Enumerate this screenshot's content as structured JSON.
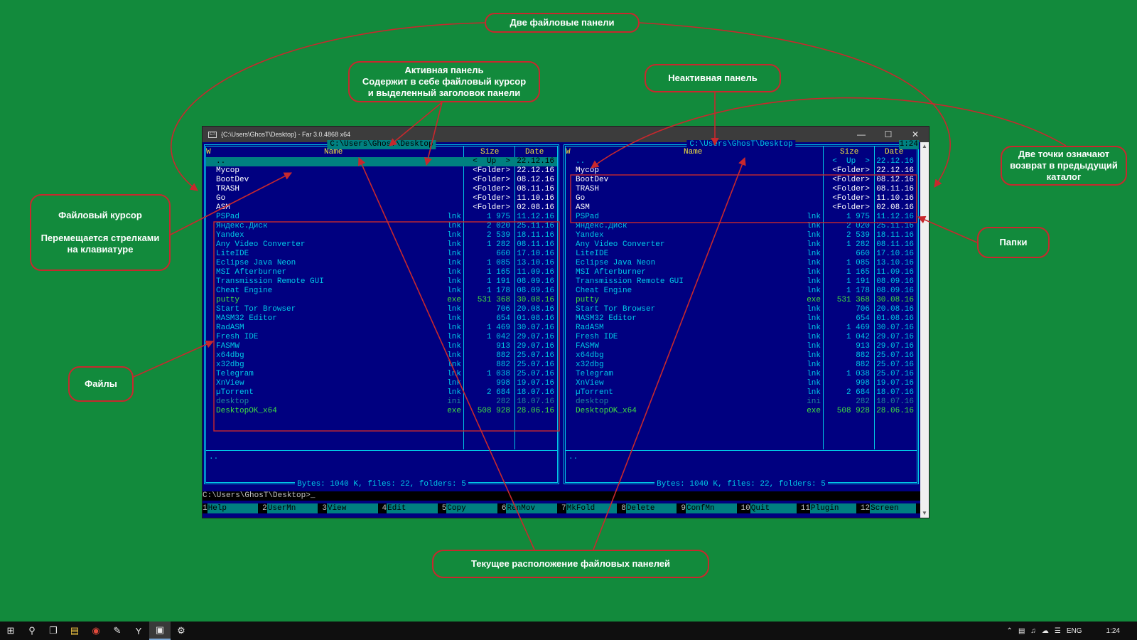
{
  "window": {
    "title": "{C:\\Users\\GhosT\\Desktop} - Far 3.0.4868 x64"
  },
  "left_panel": {
    "path": " C:\\Users\\GhosT\\Desktop ",
    "col_w": "W",
    "col_name": "Name",
    "col_size": "Size",
    "col_date": "Date",
    "info": "..",
    "status": " Bytes: 1040 K, files: 22, folders: 5 "
  },
  "right_panel": {
    "path": " C:\\Users\\GhosT\\Desktop ",
    "col_w": "W",
    "col_name": "Name",
    "col_size": "Size",
    "col_date": "Date",
    "clock": "1:24",
    "info": "..",
    "status": " Bytes: 1040 K, files: 22, folders: 5 "
  },
  "files": [
    {
      "name": "..",
      "ext": "",
      "size": "<  Up  >",
      "date": "22.12.16",
      "type": "up"
    },
    {
      "name": "Мусор",
      "ext": "",
      "size": "<Folder>",
      "date": "22.12.16",
      "type": "folder"
    },
    {
      "name": "BootDev",
      "ext": "",
      "size": "<Folder>",
      "date": "08.12.16",
      "type": "folder"
    },
    {
      "name": "TRASH",
      "ext": "",
      "size": "<Folder>",
      "date": "08.11.16",
      "type": "folder"
    },
    {
      "name": "Go",
      "ext": "",
      "size": "<Folder>",
      "date": "11.10.16",
      "type": "folder"
    },
    {
      "name": "ASM",
      "ext": "",
      "size": "<Folder>",
      "date": "02.08.16",
      "type": "folder"
    },
    {
      "name": "PSPad",
      "ext": "lnk",
      "size": "1 975",
      "date": "11.12.16",
      "type": "link"
    },
    {
      "name": "Яндекс.Диск",
      "ext": "lnk",
      "size": "2 020",
      "date": "25.11.16",
      "type": "link"
    },
    {
      "name": "Yandex",
      "ext": "lnk",
      "size": "2 539",
      "date": "18.11.16",
      "type": "link"
    },
    {
      "name": "Any Video Converter",
      "ext": "lnk",
      "size": "1 282",
      "date": "08.11.16",
      "type": "link"
    },
    {
      "name": "LiteIDE",
      "ext": "lnk",
      "size": "660",
      "date": "17.10.16",
      "type": "link"
    },
    {
      "name": "Eclipse Java Neon",
      "ext": "lnk",
      "size": "1 085",
      "date": "13.10.16",
      "type": "link"
    },
    {
      "name": "MSI Afterburner",
      "ext": "lnk",
      "size": "1 165",
      "date": "11.09.16",
      "type": "link"
    },
    {
      "name": "Transmission Remote GUI",
      "ext": "lnk",
      "size": "1 191",
      "date": "08.09.16",
      "type": "link"
    },
    {
      "name": "Cheat Engine",
      "ext": "lnk",
      "size": "1 178",
      "date": "08.09.16",
      "type": "link"
    },
    {
      "name": "putty",
      "ext": "exe",
      "size": "531 368",
      "date": "30.08.16",
      "type": "exe"
    },
    {
      "name": "Start Tor Browser",
      "ext": "lnk",
      "size": "706",
      "date": "20.08.16",
      "type": "link"
    },
    {
      "name": "MASM32 Editor",
      "ext": "lnk",
      "size": "654",
      "date": "01.08.16",
      "type": "link"
    },
    {
      "name": "RadASM",
      "ext": "lnk",
      "size": "1 469",
      "date": "30.07.16",
      "type": "link"
    },
    {
      "name": "Fresh IDE",
      "ext": "lnk",
      "size": "1 042",
      "date": "29.07.16",
      "type": "link"
    },
    {
      "name": "FASMW",
      "ext": "lnk",
      "size": "913",
      "date": "29.07.16",
      "type": "link"
    },
    {
      "name": "x64dbg",
      "ext": "lnk",
      "size": "882",
      "date": "25.07.16",
      "type": "link"
    },
    {
      "name": "x32dbg",
      "ext": "lnk",
      "size": "882",
      "date": "25.07.16",
      "type": "link"
    },
    {
      "name": "Telegram",
      "ext": "lnk",
      "size": "1 038",
      "date": "25.07.16",
      "type": "link"
    },
    {
      "name": "XnView",
      "ext": "lnk",
      "size": "998",
      "date": "19.07.16",
      "type": "link"
    },
    {
      "name": "µTorrent",
      "ext": "lnk",
      "size": "2 684",
      "date": "18.07.16",
      "type": "link"
    },
    {
      "name": "desktop",
      "ext": "ini",
      "size": "282",
      "date": "18.07.16",
      "type": "ini"
    },
    {
      "name": "DesktopOK_x64",
      "ext": "exe",
      "size": "508 928",
      "date": "28.06.16",
      "type": "exe"
    }
  ],
  "cursor_index": 0,
  "command_line": "C:\\Users\\GhosT\\Desktop>_",
  "keybar": [
    {
      "num": "1",
      "label": "Help"
    },
    {
      "num": "2",
      "label": "UserMn"
    },
    {
      "num": "3",
      "label": "View"
    },
    {
      "num": "4",
      "label": "Edit"
    },
    {
      "num": "5",
      "label": "Copy"
    },
    {
      "num": "6",
      "label": "RenMov"
    },
    {
      "num": "7",
      "label": "MkFold"
    },
    {
      "num": "8",
      "label": "Delete"
    },
    {
      "num": "9",
      "label": "ConfMn"
    },
    {
      "num": "10",
      "label": "Quit"
    },
    {
      "num": "11",
      "label": "Plugin"
    },
    {
      "num": "12",
      "label": "Screen"
    }
  ],
  "annotations": {
    "two_panels": "Две файловые панели",
    "active_panel": "Активная панель\nСодержит в себе файловый курсор\nи выделенный заголовок панели",
    "inactive_panel": "Неактивная панель",
    "two_dots": "Две точки означают\nвозврат в предыдущий\nкаталог",
    "file_cursor": "Файловый курсор\n\nПеремещается стрелками\nна клавиатуре",
    "folders": "Папки",
    "files": "Файлы",
    "current_location": "Текущее расположение файловых панелей"
  },
  "taskbar": {
    "lang": "ENG",
    "time": "1:24",
    "icons": [
      "windows-start-icon",
      "search-icon",
      "task-view-icon",
      "file-explorer-icon",
      "chrome-icon",
      "notepad-icon",
      "yandex-browser-icon",
      "far-console-icon",
      "settings-gear-icon"
    ]
  },
  "colors": {
    "background": "#128a3c",
    "annotation_red": "#c8282d",
    "panel_bg": "#000080",
    "panel_frame": "#00c8e6",
    "cursor_bg": "#008080",
    "header_text": "#f0e040",
    "exe_text": "#40e040"
  }
}
